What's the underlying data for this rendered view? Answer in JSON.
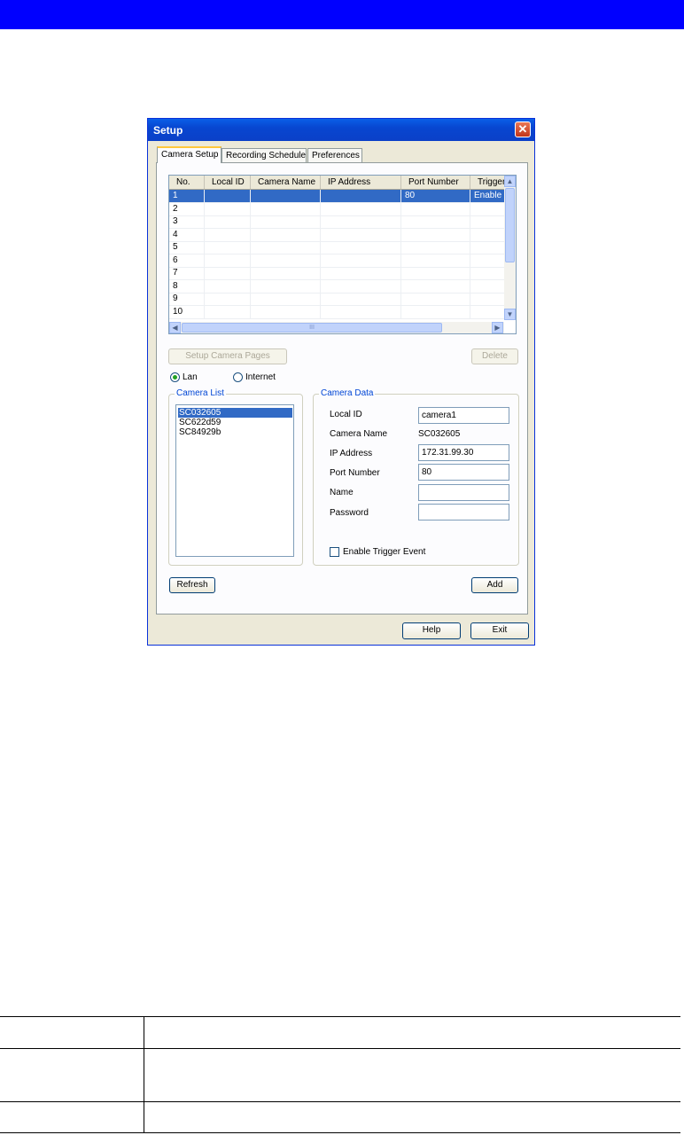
{
  "window": {
    "title": "Setup",
    "close_glyph": "✕"
  },
  "tabs": [
    {
      "label": "Camera Setup"
    },
    {
      "label": "Recording Schedule"
    },
    {
      "label": "Preferences"
    }
  ],
  "camera_grid": {
    "columns": [
      "No.",
      "Local ID",
      "Camera Name",
      "IP Address",
      "Port Number",
      "Trigger"
    ],
    "rows": [
      {
        "no": "1",
        "local_id": "",
        "camera_name": "",
        "ip": "",
        "port": "80",
        "trigger": "Enable"
      },
      {
        "no": "2"
      },
      {
        "no": "3"
      },
      {
        "no": "4"
      },
      {
        "no": "5"
      },
      {
        "no": "6"
      },
      {
        "no": "7"
      },
      {
        "no": "8"
      },
      {
        "no": "9"
      },
      {
        "no": "10"
      }
    ],
    "scroll_thumb_glyph": "III"
  },
  "buttons": {
    "setup_camera_pages": "Setup Camera Pages",
    "delete": "Delete",
    "refresh": "Refresh",
    "add": "Add",
    "help": "Help",
    "exit": "Exit"
  },
  "connection": {
    "lan_label": "Lan",
    "internet_label": "Internet",
    "selected": "Lan"
  },
  "camera_list": {
    "title": "Camera List",
    "items": [
      "SC032605",
      "SC622d59",
      "SC84929b"
    ],
    "selected_index": 0
  },
  "camera_data": {
    "title": "Camera Data",
    "local_id_label": "Local ID",
    "local_id_value": "camera1",
    "camera_name_label": "Camera Name",
    "camera_name_value": "SC032605",
    "ip_label": "IP Address",
    "ip_value": "172.31.99.30",
    "port_label": "Port Number",
    "port_value": "80",
    "name_label": "Name",
    "name_value": "",
    "password_label": "Password",
    "password_value": "",
    "trigger_label": "Enable Trigger Event",
    "trigger_checked": false
  },
  "colors": {
    "banner": "#0000ff",
    "titlebar": "#0a5fe8",
    "selection": "#316ac5",
    "group_title": "#0046d5"
  }
}
